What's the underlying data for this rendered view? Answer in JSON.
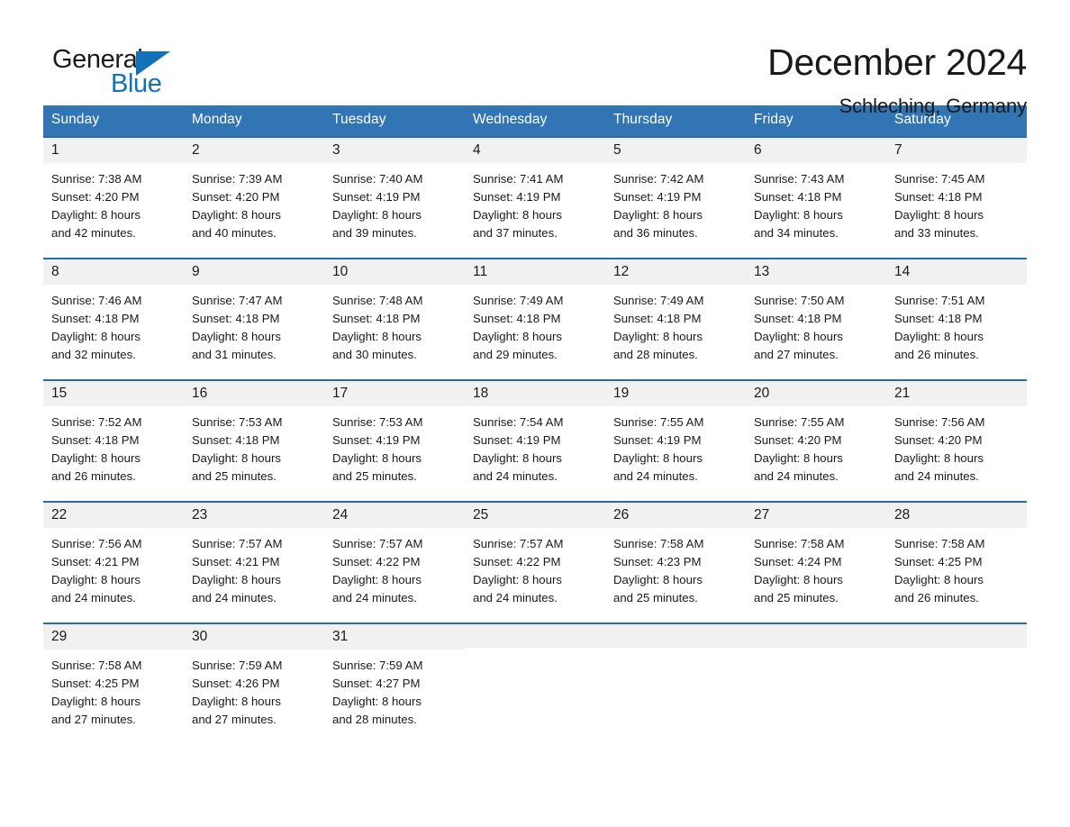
{
  "logo": {
    "word1": "General",
    "word2": "Blue",
    "triangle_color": "#1271b8"
  },
  "header": {
    "title": "December 2024",
    "subtitle": "Schleching, Germany",
    "header_bg": "#3175b4",
    "row_border": "#2a6ca8",
    "daynum_bg": "#f1f1f1"
  },
  "weekday_headers": [
    "Sunday",
    "Monday",
    "Tuesday",
    "Wednesday",
    "Thursday",
    "Friday",
    "Saturday"
  ],
  "weeks": [
    {
      "days": [
        {
          "day": "1",
          "sunrise": "Sunrise: 7:38 AM",
          "sunset": "Sunset: 4:20 PM",
          "daylight1": "Daylight: 8 hours",
          "daylight2": "and 42 minutes."
        },
        {
          "day": "2",
          "sunrise": "Sunrise: 7:39 AM",
          "sunset": "Sunset: 4:20 PM",
          "daylight1": "Daylight: 8 hours",
          "daylight2": "and 40 minutes."
        },
        {
          "day": "3",
          "sunrise": "Sunrise: 7:40 AM",
          "sunset": "Sunset: 4:19 PM",
          "daylight1": "Daylight: 8 hours",
          "daylight2": "and 39 minutes."
        },
        {
          "day": "4",
          "sunrise": "Sunrise: 7:41 AM",
          "sunset": "Sunset: 4:19 PM",
          "daylight1": "Daylight: 8 hours",
          "daylight2": "and 37 minutes."
        },
        {
          "day": "5",
          "sunrise": "Sunrise: 7:42 AM",
          "sunset": "Sunset: 4:19 PM",
          "daylight1": "Daylight: 8 hours",
          "daylight2": "and 36 minutes."
        },
        {
          "day": "6",
          "sunrise": "Sunrise: 7:43 AM",
          "sunset": "Sunset: 4:18 PM",
          "daylight1": "Daylight: 8 hours",
          "daylight2": "and 34 minutes."
        },
        {
          "day": "7",
          "sunrise": "Sunrise: 7:45 AM",
          "sunset": "Sunset: 4:18 PM",
          "daylight1": "Daylight: 8 hours",
          "daylight2": "and 33 minutes."
        }
      ]
    },
    {
      "days": [
        {
          "day": "8",
          "sunrise": "Sunrise: 7:46 AM",
          "sunset": "Sunset: 4:18 PM",
          "daylight1": "Daylight: 8 hours",
          "daylight2": "and 32 minutes."
        },
        {
          "day": "9",
          "sunrise": "Sunrise: 7:47 AM",
          "sunset": "Sunset: 4:18 PM",
          "daylight1": "Daylight: 8 hours",
          "daylight2": "and 31 minutes."
        },
        {
          "day": "10",
          "sunrise": "Sunrise: 7:48 AM",
          "sunset": "Sunset: 4:18 PM",
          "daylight1": "Daylight: 8 hours",
          "daylight2": "and 30 minutes."
        },
        {
          "day": "11",
          "sunrise": "Sunrise: 7:49 AM",
          "sunset": "Sunset: 4:18 PM",
          "daylight1": "Daylight: 8 hours",
          "daylight2": "and 29 minutes."
        },
        {
          "day": "12",
          "sunrise": "Sunrise: 7:49 AM",
          "sunset": "Sunset: 4:18 PM",
          "daylight1": "Daylight: 8 hours",
          "daylight2": "and 28 minutes."
        },
        {
          "day": "13",
          "sunrise": "Sunrise: 7:50 AM",
          "sunset": "Sunset: 4:18 PM",
          "daylight1": "Daylight: 8 hours",
          "daylight2": "and 27 minutes."
        },
        {
          "day": "14",
          "sunrise": "Sunrise: 7:51 AM",
          "sunset": "Sunset: 4:18 PM",
          "daylight1": "Daylight: 8 hours",
          "daylight2": "and 26 minutes."
        }
      ]
    },
    {
      "days": [
        {
          "day": "15",
          "sunrise": "Sunrise: 7:52 AM",
          "sunset": "Sunset: 4:18 PM",
          "daylight1": "Daylight: 8 hours",
          "daylight2": "and 26 minutes."
        },
        {
          "day": "16",
          "sunrise": "Sunrise: 7:53 AM",
          "sunset": "Sunset: 4:18 PM",
          "daylight1": "Daylight: 8 hours",
          "daylight2": "and 25 minutes."
        },
        {
          "day": "17",
          "sunrise": "Sunrise: 7:53 AM",
          "sunset": "Sunset: 4:19 PM",
          "daylight1": "Daylight: 8 hours",
          "daylight2": "and 25 minutes."
        },
        {
          "day": "18",
          "sunrise": "Sunrise: 7:54 AM",
          "sunset": "Sunset: 4:19 PM",
          "daylight1": "Daylight: 8 hours",
          "daylight2": "and 24 minutes."
        },
        {
          "day": "19",
          "sunrise": "Sunrise: 7:55 AM",
          "sunset": "Sunset: 4:19 PM",
          "daylight1": "Daylight: 8 hours",
          "daylight2": "and 24 minutes."
        },
        {
          "day": "20",
          "sunrise": "Sunrise: 7:55 AM",
          "sunset": "Sunset: 4:20 PM",
          "daylight1": "Daylight: 8 hours",
          "daylight2": "and 24 minutes."
        },
        {
          "day": "21",
          "sunrise": "Sunrise: 7:56 AM",
          "sunset": "Sunset: 4:20 PM",
          "daylight1": "Daylight: 8 hours",
          "daylight2": "and 24 minutes."
        }
      ]
    },
    {
      "days": [
        {
          "day": "22",
          "sunrise": "Sunrise: 7:56 AM",
          "sunset": "Sunset: 4:21 PM",
          "daylight1": "Daylight: 8 hours",
          "daylight2": "and 24 minutes."
        },
        {
          "day": "23",
          "sunrise": "Sunrise: 7:57 AM",
          "sunset": "Sunset: 4:21 PM",
          "daylight1": "Daylight: 8 hours",
          "daylight2": "and 24 minutes."
        },
        {
          "day": "24",
          "sunrise": "Sunrise: 7:57 AM",
          "sunset": "Sunset: 4:22 PM",
          "daylight1": "Daylight: 8 hours",
          "daylight2": "and 24 minutes."
        },
        {
          "day": "25",
          "sunrise": "Sunrise: 7:57 AM",
          "sunset": "Sunset: 4:22 PM",
          "daylight1": "Daylight: 8 hours",
          "daylight2": "and 24 minutes."
        },
        {
          "day": "26",
          "sunrise": "Sunrise: 7:58 AM",
          "sunset": "Sunset: 4:23 PM",
          "daylight1": "Daylight: 8 hours",
          "daylight2": "and 25 minutes."
        },
        {
          "day": "27",
          "sunrise": "Sunrise: 7:58 AM",
          "sunset": "Sunset: 4:24 PM",
          "daylight1": "Daylight: 8 hours",
          "daylight2": "and 25 minutes."
        },
        {
          "day": "28",
          "sunrise": "Sunrise: 7:58 AM",
          "sunset": "Sunset: 4:25 PM",
          "daylight1": "Daylight: 8 hours",
          "daylight2": "and 26 minutes."
        }
      ]
    },
    {
      "days": [
        {
          "day": "29",
          "sunrise": "Sunrise: 7:58 AM",
          "sunset": "Sunset: 4:25 PM",
          "daylight1": "Daylight: 8 hours",
          "daylight2": "and 27 minutes."
        },
        {
          "day": "30",
          "sunrise": "Sunrise: 7:59 AM",
          "sunset": "Sunset: 4:26 PM",
          "daylight1": "Daylight: 8 hours",
          "daylight2": "and 27 minutes."
        },
        {
          "day": "31",
          "sunrise": "Sunrise: 7:59 AM",
          "sunset": "Sunset: 4:27 PM",
          "daylight1": "Daylight: 8 hours",
          "daylight2": "and 28 minutes."
        },
        {
          "day": "",
          "sunrise": "",
          "sunset": "",
          "daylight1": "",
          "daylight2": ""
        },
        {
          "day": "",
          "sunrise": "",
          "sunset": "",
          "daylight1": "",
          "daylight2": ""
        },
        {
          "day": "",
          "sunrise": "",
          "sunset": "",
          "daylight1": "",
          "daylight2": ""
        },
        {
          "day": "",
          "sunrise": "",
          "sunset": "",
          "daylight1": "",
          "daylight2": ""
        }
      ]
    }
  ]
}
